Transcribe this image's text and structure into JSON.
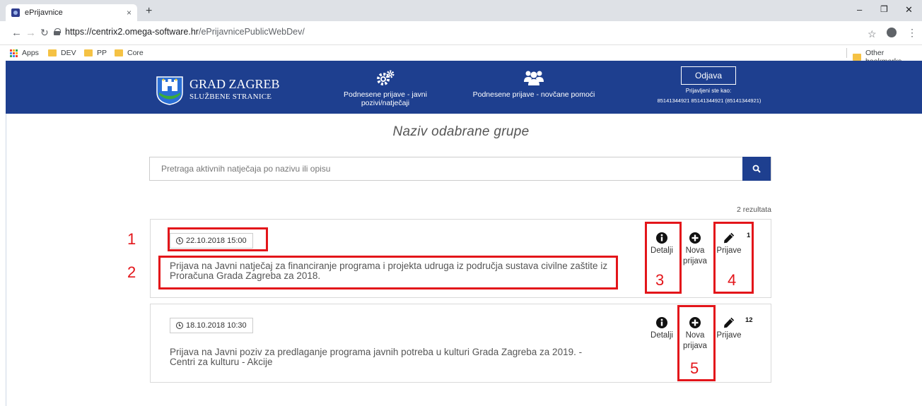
{
  "browser": {
    "tab_title": "ePrijavnice",
    "tab_close": "×",
    "new_tab": "+",
    "url_host": "https://centrix2.omega-software.hr",
    "url_path": "/ePrijavnicePublicWebDev/",
    "bookmarks": [
      "Apps",
      "DEV",
      "PP",
      "Core"
    ],
    "other_bookmarks": "Other bookmarks"
  },
  "header": {
    "brand_title": "GRAD ZAGREB",
    "brand_subtitle": "SLUŽBENE STRANICE",
    "nav": [
      {
        "label": "Podnesene prijave - javni pozivi/natječaji",
        "icon": "gears-icon"
      },
      {
        "label": "Podnesene prijave - novčane pomoći",
        "icon": "users-icon"
      }
    ],
    "logout_label": "Odjava",
    "logged_in_label": "Prijavljeni ste kao:",
    "logged_in_user": "85141344921 85141344921 (85141344921)",
    "color": "#1e3f8f"
  },
  "main": {
    "group_title": "Naziv odabrane grupe",
    "search_placeholder": "Pretraga aktivnih natječaja po nazivu ili opisu",
    "results_count": "2 rezultata"
  },
  "cards": [
    {
      "date": "22.10.2018 15:00",
      "title": "Prijava na Javni natječaj za financiranje programa i projekta udruga iz područja sustava civilne zaštite iz Proračuna Grada Zagreba za 2018.",
      "details_label": "Detalji",
      "new_label": "Nova prijava",
      "applications_label": "Prijave",
      "applications_count": "1"
    },
    {
      "date": "18.10.2018 10:30",
      "title": "Prijava na Javni poziv za predlaganje programa javnih potreba u kulturi Grada Zagreba za 2019. - Centri za kulturu - Akcije",
      "details_label": "Detalji",
      "new_label": "Nova prijava",
      "applications_label": "Prijave",
      "applications_count": "12"
    }
  ],
  "annotations": [
    "1",
    "2",
    "3",
    "4",
    "5"
  ],
  "annotation_color": "#e3151a"
}
